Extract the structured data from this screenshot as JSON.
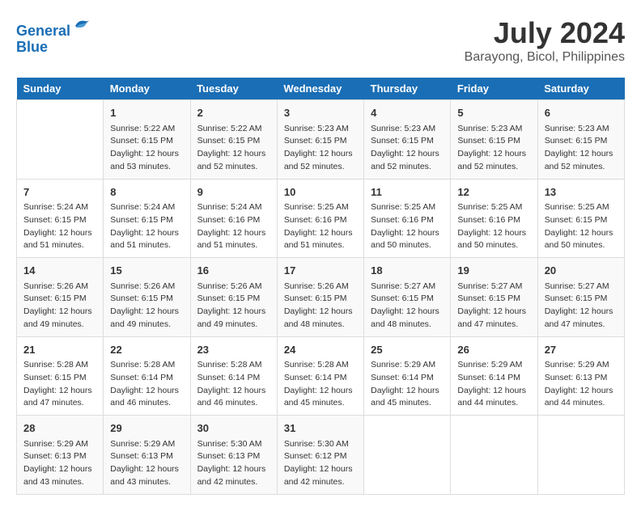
{
  "header": {
    "logo_line1": "General",
    "logo_line2": "Blue",
    "title": "July 2024",
    "subtitle": "Barayong, Bicol, Philippines"
  },
  "calendar": {
    "days_of_week": [
      "Sunday",
      "Monday",
      "Tuesday",
      "Wednesday",
      "Thursday",
      "Friday",
      "Saturday"
    ],
    "weeks": [
      [
        {
          "day": "",
          "info": ""
        },
        {
          "day": "1",
          "info": "Sunrise: 5:22 AM\nSunset: 6:15 PM\nDaylight: 12 hours\nand 53 minutes."
        },
        {
          "day": "2",
          "info": "Sunrise: 5:22 AM\nSunset: 6:15 PM\nDaylight: 12 hours\nand 52 minutes."
        },
        {
          "day": "3",
          "info": "Sunrise: 5:23 AM\nSunset: 6:15 PM\nDaylight: 12 hours\nand 52 minutes."
        },
        {
          "day": "4",
          "info": "Sunrise: 5:23 AM\nSunset: 6:15 PM\nDaylight: 12 hours\nand 52 minutes."
        },
        {
          "day": "5",
          "info": "Sunrise: 5:23 AM\nSunset: 6:15 PM\nDaylight: 12 hours\nand 52 minutes."
        },
        {
          "day": "6",
          "info": "Sunrise: 5:23 AM\nSunset: 6:15 PM\nDaylight: 12 hours\nand 52 minutes."
        }
      ],
      [
        {
          "day": "7",
          "info": "Sunrise: 5:24 AM\nSunset: 6:15 PM\nDaylight: 12 hours\nand 51 minutes."
        },
        {
          "day": "8",
          "info": "Sunrise: 5:24 AM\nSunset: 6:15 PM\nDaylight: 12 hours\nand 51 minutes."
        },
        {
          "day": "9",
          "info": "Sunrise: 5:24 AM\nSunset: 6:16 PM\nDaylight: 12 hours\nand 51 minutes."
        },
        {
          "day": "10",
          "info": "Sunrise: 5:25 AM\nSunset: 6:16 PM\nDaylight: 12 hours\nand 51 minutes."
        },
        {
          "day": "11",
          "info": "Sunrise: 5:25 AM\nSunset: 6:16 PM\nDaylight: 12 hours\nand 50 minutes."
        },
        {
          "day": "12",
          "info": "Sunrise: 5:25 AM\nSunset: 6:16 PM\nDaylight: 12 hours\nand 50 minutes."
        },
        {
          "day": "13",
          "info": "Sunrise: 5:25 AM\nSunset: 6:15 PM\nDaylight: 12 hours\nand 50 minutes."
        }
      ],
      [
        {
          "day": "14",
          "info": "Sunrise: 5:26 AM\nSunset: 6:15 PM\nDaylight: 12 hours\nand 49 minutes."
        },
        {
          "day": "15",
          "info": "Sunrise: 5:26 AM\nSunset: 6:15 PM\nDaylight: 12 hours\nand 49 minutes."
        },
        {
          "day": "16",
          "info": "Sunrise: 5:26 AM\nSunset: 6:15 PM\nDaylight: 12 hours\nand 49 minutes."
        },
        {
          "day": "17",
          "info": "Sunrise: 5:26 AM\nSunset: 6:15 PM\nDaylight: 12 hours\nand 48 minutes."
        },
        {
          "day": "18",
          "info": "Sunrise: 5:27 AM\nSunset: 6:15 PM\nDaylight: 12 hours\nand 48 minutes."
        },
        {
          "day": "19",
          "info": "Sunrise: 5:27 AM\nSunset: 6:15 PM\nDaylight: 12 hours\nand 47 minutes."
        },
        {
          "day": "20",
          "info": "Sunrise: 5:27 AM\nSunset: 6:15 PM\nDaylight: 12 hours\nand 47 minutes."
        }
      ],
      [
        {
          "day": "21",
          "info": "Sunrise: 5:28 AM\nSunset: 6:15 PM\nDaylight: 12 hours\nand 47 minutes."
        },
        {
          "day": "22",
          "info": "Sunrise: 5:28 AM\nSunset: 6:14 PM\nDaylight: 12 hours\nand 46 minutes."
        },
        {
          "day": "23",
          "info": "Sunrise: 5:28 AM\nSunset: 6:14 PM\nDaylight: 12 hours\nand 46 minutes."
        },
        {
          "day": "24",
          "info": "Sunrise: 5:28 AM\nSunset: 6:14 PM\nDaylight: 12 hours\nand 45 minutes."
        },
        {
          "day": "25",
          "info": "Sunrise: 5:29 AM\nSunset: 6:14 PM\nDaylight: 12 hours\nand 45 minutes."
        },
        {
          "day": "26",
          "info": "Sunrise: 5:29 AM\nSunset: 6:14 PM\nDaylight: 12 hours\nand 44 minutes."
        },
        {
          "day": "27",
          "info": "Sunrise: 5:29 AM\nSunset: 6:13 PM\nDaylight: 12 hours\nand 44 minutes."
        }
      ],
      [
        {
          "day": "28",
          "info": "Sunrise: 5:29 AM\nSunset: 6:13 PM\nDaylight: 12 hours\nand 43 minutes."
        },
        {
          "day": "29",
          "info": "Sunrise: 5:29 AM\nSunset: 6:13 PM\nDaylight: 12 hours\nand 43 minutes."
        },
        {
          "day": "30",
          "info": "Sunrise: 5:30 AM\nSunset: 6:13 PM\nDaylight: 12 hours\nand 42 minutes."
        },
        {
          "day": "31",
          "info": "Sunrise: 5:30 AM\nSunset: 6:12 PM\nDaylight: 12 hours\nand 42 minutes."
        },
        {
          "day": "",
          "info": ""
        },
        {
          "day": "",
          "info": ""
        },
        {
          "day": "",
          "info": ""
        }
      ]
    ]
  }
}
